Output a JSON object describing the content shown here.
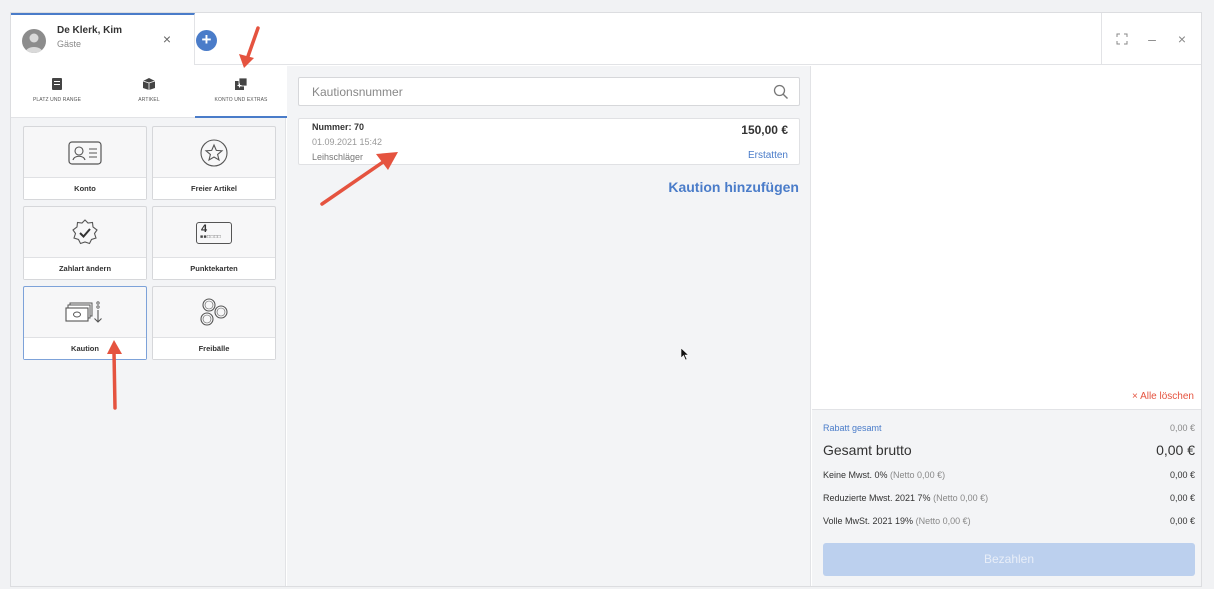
{
  "guest_tab": {
    "name": "De Klerk, Kim",
    "group": "Gäste",
    "close_symbol": "×",
    "add_symbol": "+"
  },
  "window_controls": {
    "fullscreen_symbol": "⛶",
    "minimize_symbol": "–",
    "close_symbol": "×"
  },
  "category_tabs": [
    {
      "label": "PLATZ UND RANGE",
      "icon": "calendar-icon"
    },
    {
      "label": "ARTIKEL",
      "icon": "box-icon"
    },
    {
      "label": "KONTO UND EXTRAS",
      "icon": "extras-icon",
      "active": true
    }
  ],
  "tiles": [
    {
      "label": "Konto",
      "icon": "account-card-icon"
    },
    {
      "label": "Freier Artikel",
      "icon": "star-icon"
    },
    {
      "label": "Zahlart ändern",
      "icon": "check-badge-icon"
    },
    {
      "label": "Punktekarten",
      "icon": "punch-card-icon",
      "icon_text": "4"
    },
    {
      "label": "Kaution",
      "icon": "cash-deposit-icon",
      "selected": true
    },
    {
      "label": "Freibälle",
      "icon": "balls-icon"
    }
  ],
  "search": {
    "placeholder": "Kautionsnummer",
    "value": ""
  },
  "deposits": [
    {
      "number": "Nummer: 70",
      "date": "01.09.2021 15:42",
      "item": "Leihschläger",
      "amount": "150,00 €",
      "action": "Erstatten"
    }
  ],
  "add_deposit_label": "Kaution hinzufügen",
  "cart": {
    "clear_all_label": "× Alle löschen",
    "discount_label": "Rabatt gesamt",
    "discount_value": "0,00 €",
    "gross_label": "Gesamt brutto",
    "gross_value": "0,00 €",
    "tax_rows": [
      {
        "label": "Keine Mwst. 0%",
        "net": "(Netto 0,00 €)",
        "value": "0,00 €"
      },
      {
        "label": "Reduzierte Mwst. 2021 7%",
        "net": "(Netto 0,00 €)",
        "value": "0,00 €"
      },
      {
        "label": "Volle MwSt. 2021 19%",
        "net": "(Netto 0,00 €)",
        "value": "0,00 €"
      }
    ],
    "pay_label": "Bezahlen"
  },
  "colors": {
    "accent": "#4a7cc9",
    "annotation_arrow": "#e5533f",
    "danger": "#e5533f",
    "pay_disabled": "#bcd0ee"
  }
}
